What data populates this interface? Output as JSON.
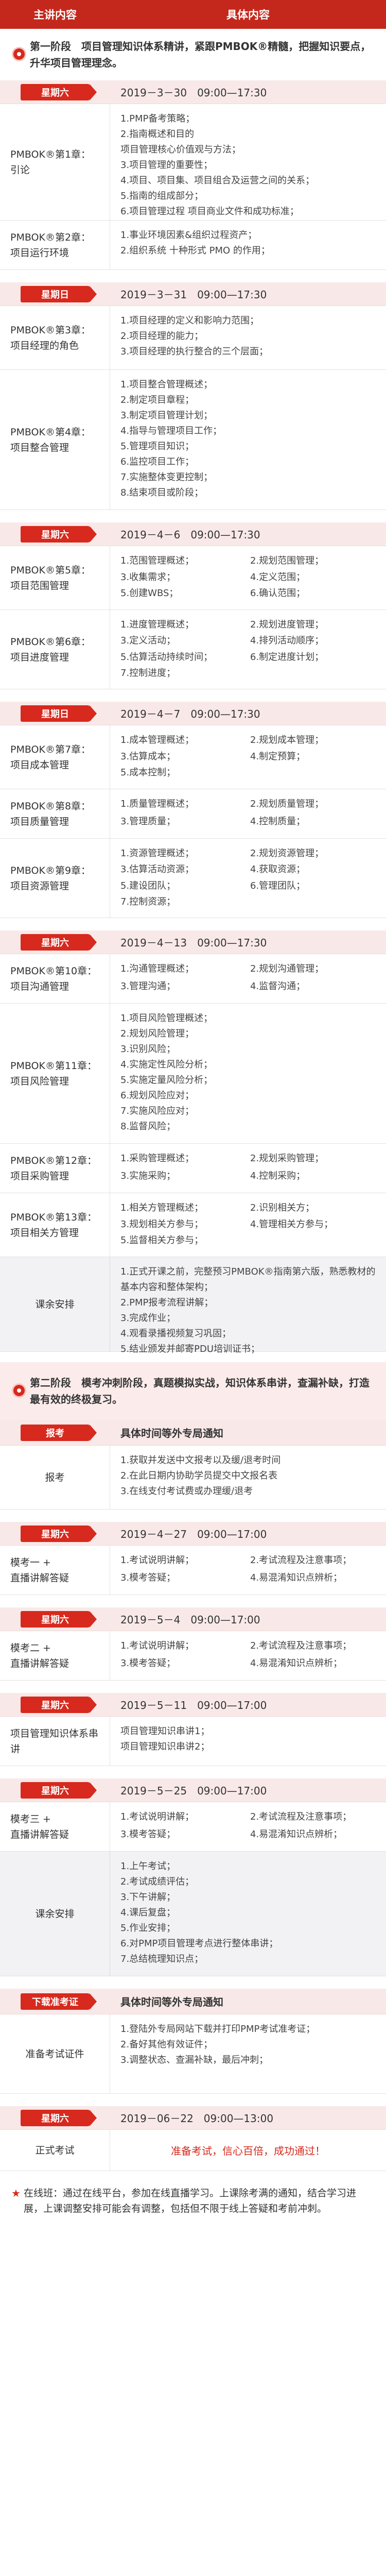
{
  "header": {
    "col1": "主讲内容",
    "col2": "具体内容"
  },
  "phase1": "第一阶段　项目管理知识体系精讲，紧跟PMBOK®精髓，把握知识要点，升华项目管理理念。",
  "b1": {
    "day": "星期六",
    "date": "2019－3－30　09:00—17:30",
    "rows": [
      {
        "left": "PMBOK®第1章：引论",
        "lines": [
          "1.PMP备考策略；",
          "2.指南概述和目的",
          "项目管理核心价值观与方法；",
          "3.项目管理的重要性；",
          "4.项目、项目集、项目组合及运营之间的关系；",
          "5.指南的组成部分；",
          "6.项目管理过程 项目商业文件和成功标准；"
        ]
      },
      {
        "left": "PMBOK®第2章：项目运行环境",
        "lines": [
          "1.事业环境因素&组织过程资产；",
          "2.组织系统 十种形式 PMO 的作用；"
        ]
      }
    ]
  },
  "b2": {
    "day": "星期日",
    "date": "2019－3－31　09:00—17:30",
    "rows": [
      {
        "left": "PMBOK®第3章：项目经理的角色",
        "lines": [
          "1.项目经理的定义和影响力范围；",
          "2.项目经理的能力；",
          "3.项目经理的执行整合的三个层面；"
        ]
      },
      {
        "left": "PMBOK®第4章：项目整合管理",
        "lines": [
          "1.项目整合管理概述；",
          "2.制定项目章程；",
          "3.制定项目管理计划；",
          "4.指导与管理项目工作；",
          "5.管理项目知识；",
          "6.监控项目工作；",
          "7.实施整体变更控制；",
          "8.结束项目或阶段；"
        ]
      }
    ]
  },
  "b3": {
    "day": "星期六",
    "date": "2019－4－6　09:00—17:30",
    "rows": [
      {
        "left": "PMBOK®第5章：项目范围管理",
        "lines": [
          "1.范围管理概述；",
          "2.规划范围管理；",
          "3.收集需求；",
          "4.定义范围；",
          "5.创建WBS；",
          "6.确认范围；"
        ]
      },
      {
        "left": "PMBOK®第6章：项目进度管理",
        "lines": [
          "1.进度管理概述；",
          "2.规划进度管理；",
          "3.定义活动；",
          "4.排列活动顺序；",
          "5.估算活动持续时间；",
          "6.制定进度计划；",
          "7.控制进度；"
        ]
      }
    ]
  },
  "b4": {
    "day": "星期日",
    "date": "2019－4－7　09:00—17:30",
    "rows": [
      {
        "left": "PMBOK®第7章：项目成本管理",
        "lines": [
          "1.成本管理概述；",
          "2.规划成本管理；",
          "3.估算成本；",
          "4.制定预算；",
          "5.成本控制；"
        ]
      },
      {
        "left": "PMBOK®第8章：项目质量管理",
        "lines": [
          "1.质量管理概述；",
          "2.规划质量管理；",
          "3.管理质量；",
          "4.控制质量；"
        ]
      },
      {
        "left": "PMBOK®第9章：项目资源管理",
        "lines": [
          "1.资源管理概述；",
          "2.规划资源管理；",
          "3.估算活动资源；",
          "4.获取资源；",
          "5.建设团队；",
          "6.管理团队；",
          "7.控制资源；"
        ]
      }
    ]
  },
  "b5": {
    "day": "星期六",
    "date": "2019－4－13　09:00—17:30",
    "rows": [
      {
        "left": "PMBOK®第10章：项目沟通管理",
        "lines": [
          "1.沟通管理概述；",
          "2.规划沟通管理；",
          "3.管理沟通；",
          "4.监督沟通；"
        ]
      },
      {
        "left": "PMBOK®第11章：项目风险管理",
        "lines": [
          "1.项目风险管理概述；",
          "2.规划风险管理；",
          "3.识别风险；",
          "4.实施定性风险分析；",
          "5.实施定量风险分析；",
          "6.规划风险应对；",
          "7.实施风险应对；",
          "8.监督风险；"
        ]
      },
      {
        "left": "PMBOK®第12章：项目采购管理",
        "lines": [
          "1.采购管理概述；",
          "2.规划采购管理；",
          "3.实施采购；",
          "4.控制采购；"
        ]
      },
      {
        "left": "PMBOK®第13章：项目相关方管理",
        "lines": [
          "1.相关方管理概述；",
          "2.识别相关方；",
          "3.规划相关方参与；",
          "4.管理相关方参与；",
          "5.监督相关方参与；"
        ]
      }
    ]
  },
  "arrange1": {
    "left": "课余安排",
    "lines": [
      "1.正式开课之前，完整预习PMBOK®指南第六版，熟悉教材的基本内容和整体架构；",
      "2.PMP报考流程讲解；",
      "3.完成作业；",
      "4.观看录播视频复习巩固；",
      "5.结业颁发并邮寄PDU培训证书；"
    ]
  },
  "phase2": "第二阶段　模考冲刺阶段，真题模拟实战，知识体系串讲，查漏补缺，打造最有效的终极复习。",
  "enroll": {
    "day": "报考",
    "title": "具体时间等外专局通知",
    "left": "报考",
    "lines": [
      "1.获取并发送中文报考以及缓/退考时间",
      "2.在此日期内协助学员提交中文报名表",
      "3.在线支付考试费或办理缓/退考"
    ]
  },
  "m1": {
    "day": "星期六",
    "date": "2019－4－27　09:00—17:00",
    "left": "模考一 +\n直播讲解答疑",
    "lines": [
      "1.考试说明讲解；",
      "2.考试流程及注意事项；",
      "3.模考答疑；",
      "4.易混淆知识点辨析；"
    ]
  },
  "m2": {
    "day": "星期六",
    "date": "2019－5－4　09:00—17:00",
    "left": "模考二 +\n直播讲解答疑",
    "lines": [
      "1.考试说明讲解；",
      "2.考试流程及注意事项；",
      "3.模考答疑；",
      "4.易混淆知识点辨析；"
    ]
  },
  "m3": {
    "day": "星期六",
    "date": "2019－5－11　09:00—17:00",
    "left": "项目管理知识体系串讲",
    "lines": [
      "项目管理知识串讲1；",
      "项目管理知识串讲2；"
    ]
  },
  "m4": {
    "day": "星期六",
    "date": "2019－5－25　09:00—17:00",
    "left": "模考三 +\n直播讲解答疑",
    "lines": [
      "1.考试说明讲解；",
      "2.考试流程及注意事项；",
      "3.模考答疑；",
      "4.易混淆知识点辨析；"
    ]
  },
  "arrange2": {
    "left": "课余安排",
    "lines": [
      "1.上午考试；",
      "2.考试成绩评估；",
      "3.下午讲解；",
      "4.课后复盘；",
      "5.作业安排；",
      "6.对PMP项目管理考点进行整体串讲；",
      "7.总结梳理知识点；"
    ]
  },
  "download": {
    "day": "下载准考证",
    "title": "具体时间等外专局通知",
    "left": "准备考试证件",
    "lines": [
      "1.登陆外专局网站下载并打印PMP考试准考证；",
      "2.备好其他有效证件；",
      "3.调整状态、查漏补缺，最后冲刺；"
    ]
  },
  "exam": {
    "day": "星期六",
    "date": "2019－06－22　09:00—13:00",
    "left": "正式考试",
    "text": "准备考试，信心百倍，成功通过！"
  },
  "note": "在线班：通过在线平台，参加在线直播学习。上课除考满的通知，结合学习进展，上课调整安排可能会有调整，包括但不限于线上答疑和考前冲刺。"
}
